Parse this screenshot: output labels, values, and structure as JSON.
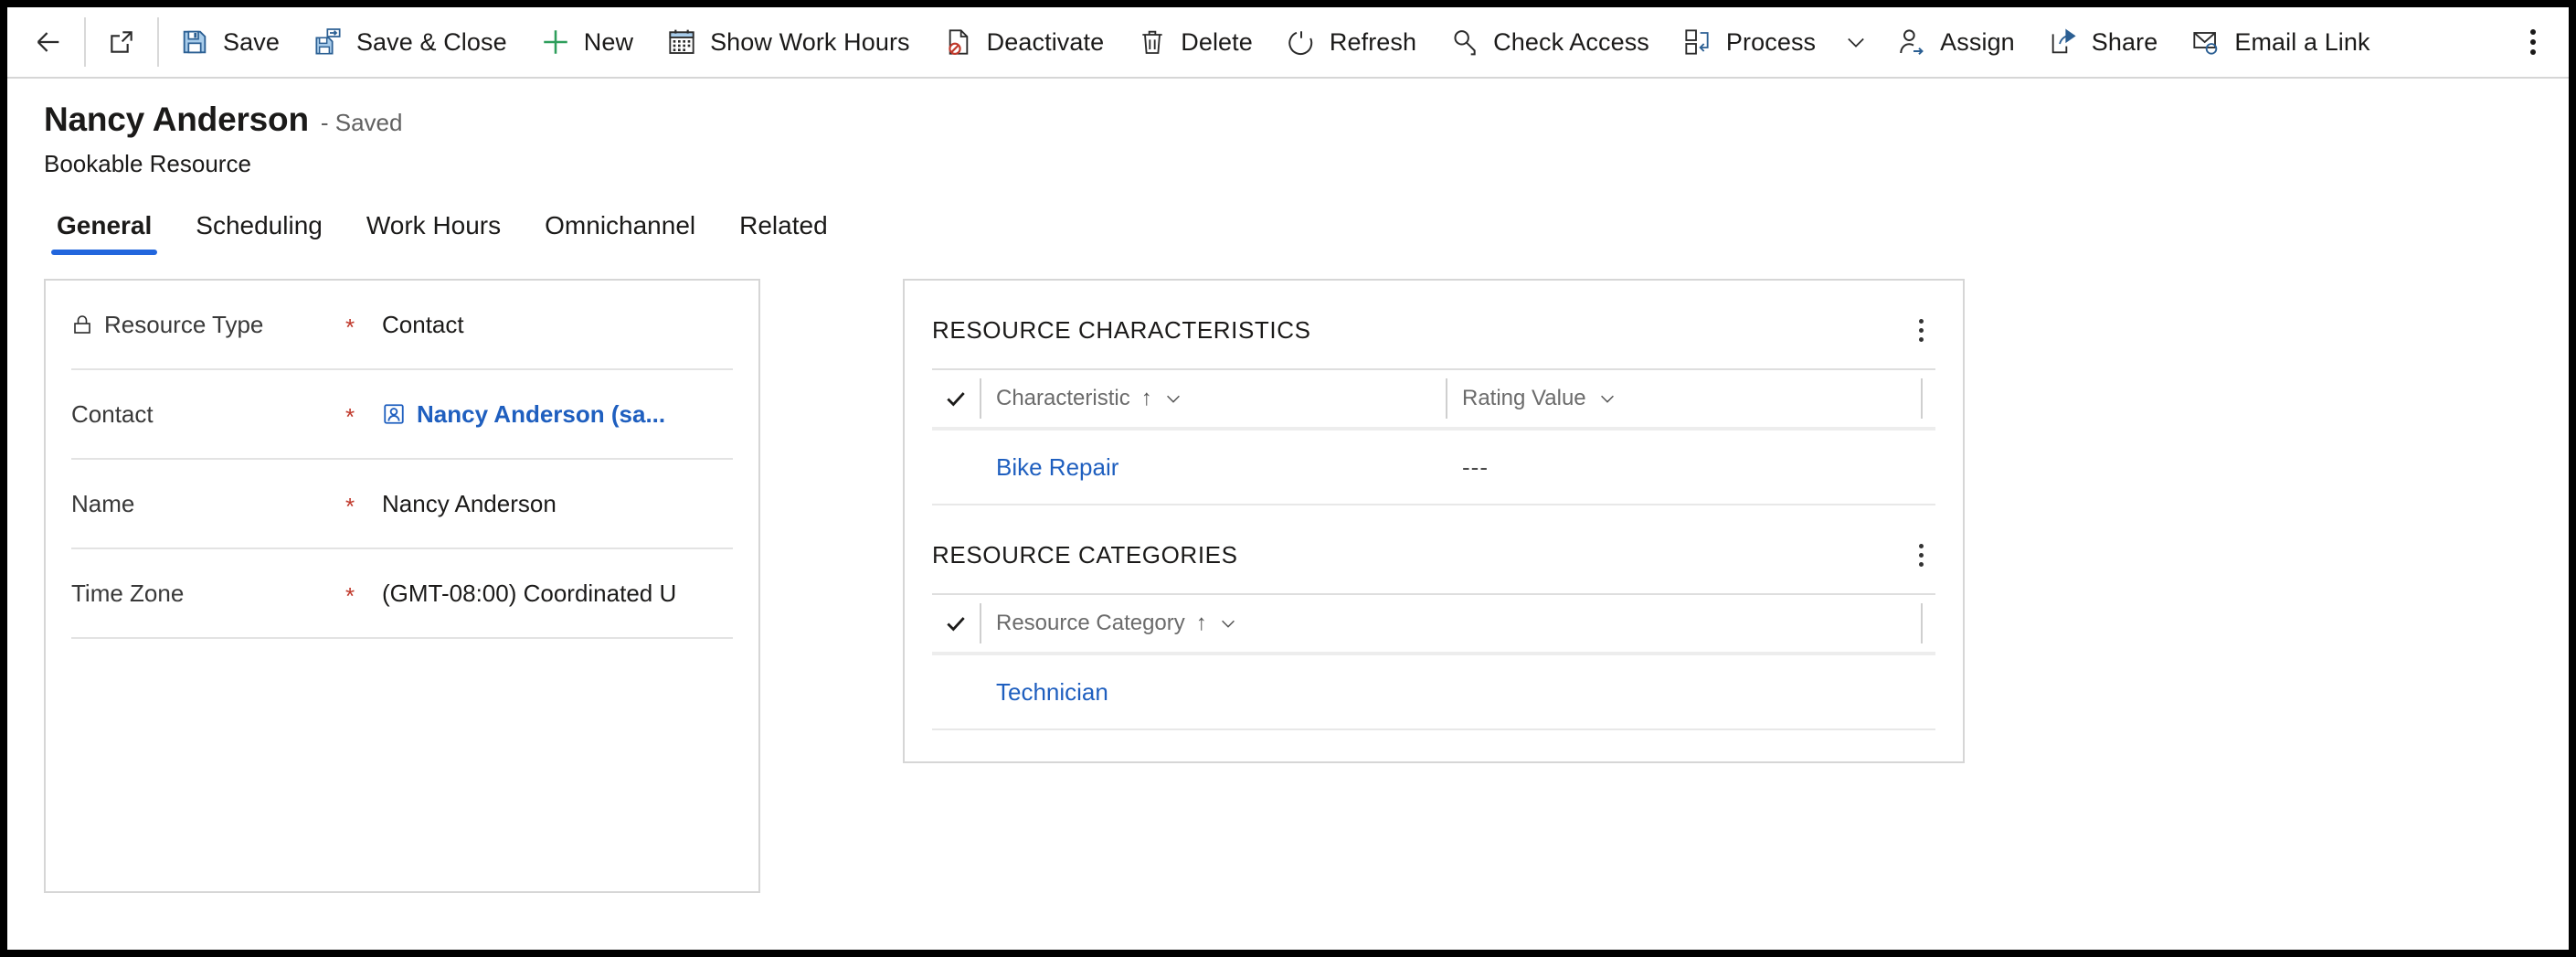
{
  "commandbar": {
    "items": [
      {
        "icon": "back-arrow-icon",
        "label": ""
      },
      {
        "icon": "popout-window-icon",
        "label": ""
      },
      {
        "icon": "save-icon",
        "label": "Save"
      },
      {
        "icon": "save-and-close-icon",
        "label": "Save & Close"
      },
      {
        "icon": "new-plus-icon",
        "label": "New"
      },
      {
        "icon": "calendar-icon",
        "label": "Show Work Hours"
      },
      {
        "icon": "deactivate-icon",
        "label": "Deactivate"
      },
      {
        "icon": "delete-trash-icon",
        "label": "Delete"
      },
      {
        "icon": "refresh-icon",
        "label": "Refresh"
      },
      {
        "icon": "check-access-key-icon",
        "label": "Check Access"
      },
      {
        "icon": "process-icon",
        "label": "Process"
      },
      {
        "icon": "assign-person-icon",
        "label": "Assign"
      },
      {
        "icon": "share-icon",
        "label": "Share"
      },
      {
        "icon": "email-a-link-icon",
        "label": "Email a Link"
      }
    ],
    "overflow_label": "More commands"
  },
  "header": {
    "title": "Nancy Anderson",
    "status": "- Saved",
    "subtitle": "Bookable Resource"
  },
  "tabs": [
    {
      "label": "General",
      "active": true
    },
    {
      "label": "Scheduling",
      "active": false
    },
    {
      "label": "Work Hours",
      "active": false
    },
    {
      "label": "Omnichannel",
      "active": false
    },
    {
      "label": "Related",
      "active": false
    }
  ],
  "form": {
    "fields": [
      {
        "label": "Resource Type",
        "locked": true,
        "required": "*",
        "value": "Contact",
        "is_link": false
      },
      {
        "label": "Contact",
        "locked": false,
        "required": "*",
        "value": "Nancy Anderson (sa...",
        "is_link": true
      },
      {
        "label": "Name",
        "locked": false,
        "required": "*",
        "value": "Nancy Anderson",
        "is_link": false
      },
      {
        "label": "Time Zone",
        "locked": false,
        "required": "*",
        "value": "(GMT-08:00) Coordinated U",
        "is_link": false
      }
    ]
  },
  "side_panel": {
    "sections": [
      {
        "title": "RESOURCE CHARACTERISTICS",
        "columns": [
          "Characteristic",
          "Rating Value"
        ],
        "sort_column": "Characteristic",
        "rows": [
          {
            "c1": "Bike Repair",
            "c2": "---"
          }
        ]
      },
      {
        "title": "RESOURCE CATEGORIES",
        "columns": [
          "Resource Category"
        ],
        "sort_column": "Resource Category",
        "rows": [
          {
            "c1": "Technician",
            "c2": ""
          }
        ]
      }
    ]
  },
  "colors": {
    "accent_blue": "#2266dd",
    "link_blue": "#1f5fbf",
    "required_red": "#c0392b",
    "new_green": "#2e9e5b",
    "border_gray": "#d6d6d6"
  }
}
